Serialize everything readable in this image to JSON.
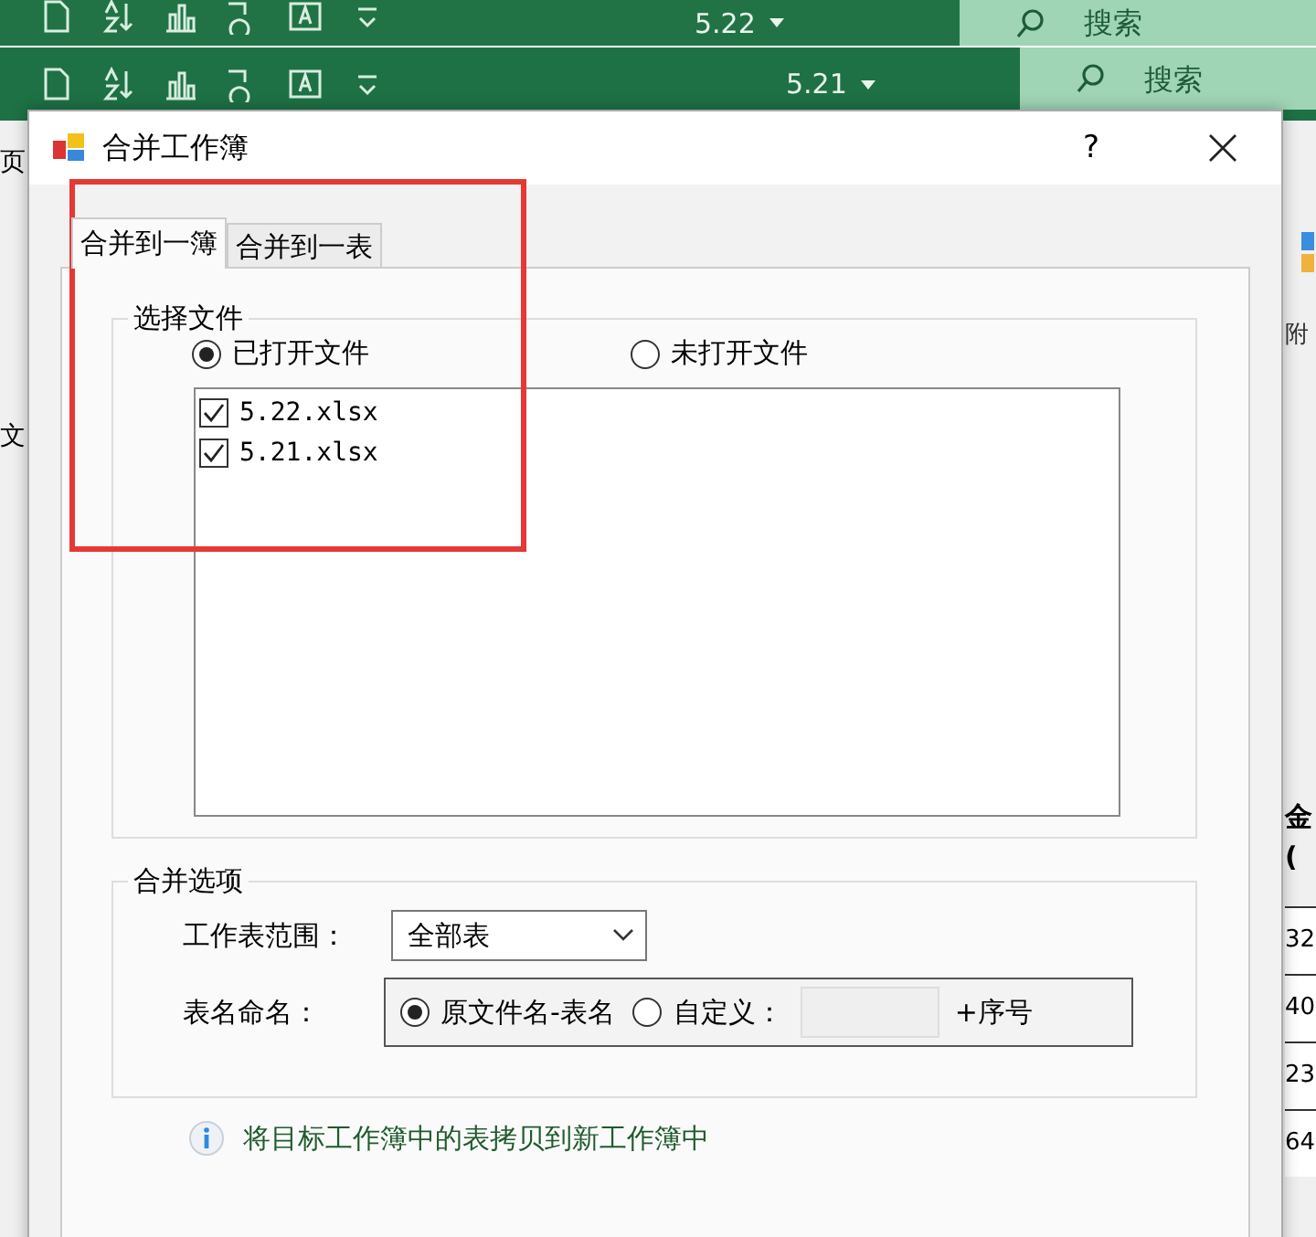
{
  "background_windows": [
    {
      "title": "5.22",
      "search": {
        "placeholder": "搜索"
      }
    },
    {
      "title": "5.21",
      "search": {
        "placeholder": "搜索"
      }
    }
  ],
  "sheet_left": [
    "页",
    "文"
  ],
  "sheet_right": {
    "label": "附",
    "header": "金",
    "header_2": "(",
    "cells": [
      "32",
      "40",
      "23",
      "64"
    ]
  },
  "dialog": {
    "title": "合并工作簿",
    "help": "?",
    "tabs": [
      {
        "label": "合并到一簿",
        "selected": true
      },
      {
        "label": "合并到一表",
        "selected": false
      }
    ],
    "file_group": {
      "legend": "选择文件",
      "sources": [
        {
          "label": "已打开文件",
          "selected": true
        },
        {
          "label": "未打开文件",
          "selected": false
        }
      ],
      "files": [
        {
          "name": "5.22.xlsx",
          "checked": true
        },
        {
          "name": "5.21.xlsx",
          "checked": true
        }
      ]
    },
    "options_group": {
      "legend": "合并选项",
      "range_label": "工作表范围：",
      "range_value": "全部表",
      "naming_label": "表名命名：",
      "naming_options": [
        {
          "label": "原文件名-表名",
          "selected": true
        },
        {
          "label": "自定义：",
          "selected": false
        }
      ],
      "suffix": "+序号"
    },
    "info": "将目标工作簿中的表拷贝到新工作簿中"
  }
}
